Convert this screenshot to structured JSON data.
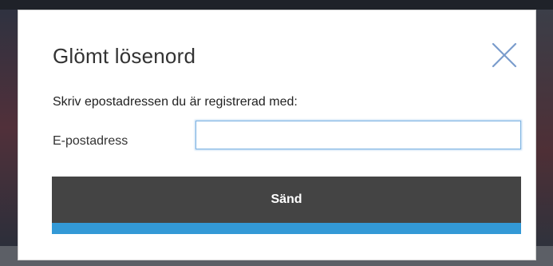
{
  "dialog": {
    "title": "Glömt lösenord",
    "close_icon": "close-icon",
    "instruction": "Skriv epostadressen du är registrerad med:",
    "email_label": "E-postadress",
    "email_value": "",
    "email_placeholder": "",
    "submit_label": "Sänd"
  },
  "colors": {
    "button_background": "#444444",
    "button_accent": "#3399d6",
    "close_icon": "#7a9ccc",
    "input_focus_border": "#7eb3e2"
  }
}
